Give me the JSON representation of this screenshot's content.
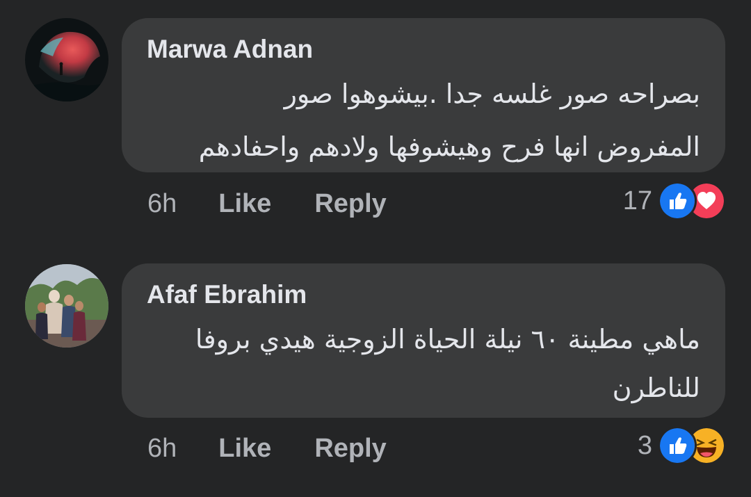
{
  "comments": [
    {
      "author": "Marwa Adnan",
      "text_line1": "بصراحه صور غلسه جدا .بيشوهوا صور",
      "text_line2": "المفروض انها فرح وهيشوفها ولادهم واحفادهم",
      "time": "6h",
      "like_label": "Like",
      "reply_label": "Reply",
      "reaction_count": "17",
      "reactions": [
        "like-icon",
        "love-icon"
      ]
    },
    {
      "author": "Afaf Ebrahim",
      "text_line1": "ماهي مطينة ٦٠ نيلة الحياة الزوجية هيدي بروفا",
      "text_line2": "للناطرن",
      "time": "6h",
      "like_label": "Like",
      "reply_label": "Reply",
      "reaction_count": "3",
      "reactions": [
        "like-icon",
        "haha-icon"
      ]
    }
  ],
  "colors": {
    "background": "#242526",
    "bubble": "#3a3b3c",
    "primary_text": "#e4e6eb",
    "secondary_text": "#b0b3b8",
    "like_blue": "#1877f2",
    "love_red": "#f33e58",
    "haha_yellow": "#f7b125"
  }
}
